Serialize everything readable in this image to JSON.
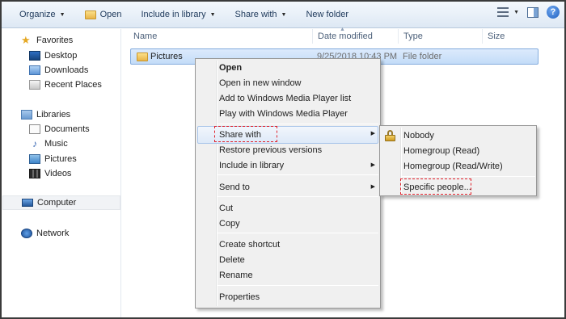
{
  "toolbar": {
    "organize": "Organize",
    "open": "Open",
    "include_in_library": "Include in library",
    "share_with": "Share with",
    "new_folder": "New folder"
  },
  "nav": {
    "favorites": "Favorites",
    "desktop": "Desktop",
    "downloads": "Downloads",
    "recent_places": "Recent Places",
    "libraries": "Libraries",
    "documents": "Documents",
    "music": "Music",
    "pictures": "Pictures",
    "videos": "Videos",
    "computer": "Computer",
    "network": "Network"
  },
  "columns": {
    "name": "Name",
    "date_modified": "Date modified",
    "type": "Type",
    "size": "Size"
  },
  "file_row": {
    "name": "Pictures",
    "date_modified": "9/25/2018 10:43 PM",
    "type": "File folder"
  },
  "context_menu": {
    "open": "Open",
    "open_new_window": "Open in new window",
    "add_wmp_list": "Add to Windows Media Player list",
    "play_wmp": "Play with Windows Media Player",
    "share_with": "Share with",
    "restore_previous": "Restore previous versions",
    "include_in_library": "Include in library",
    "send_to": "Send to",
    "cut": "Cut",
    "copy": "Copy",
    "create_shortcut": "Create shortcut",
    "delete": "Delete",
    "rename": "Rename",
    "properties": "Properties"
  },
  "share_submenu": {
    "nobody": "Nobody",
    "homegroup_read": "Homegroup (Read)",
    "homegroup_read_write": "Homegroup (Read/Write)",
    "specific_people": "Specific people..."
  },
  "colors": {
    "highlight_box": "#e0202a",
    "selection": "#c3dcf8"
  }
}
